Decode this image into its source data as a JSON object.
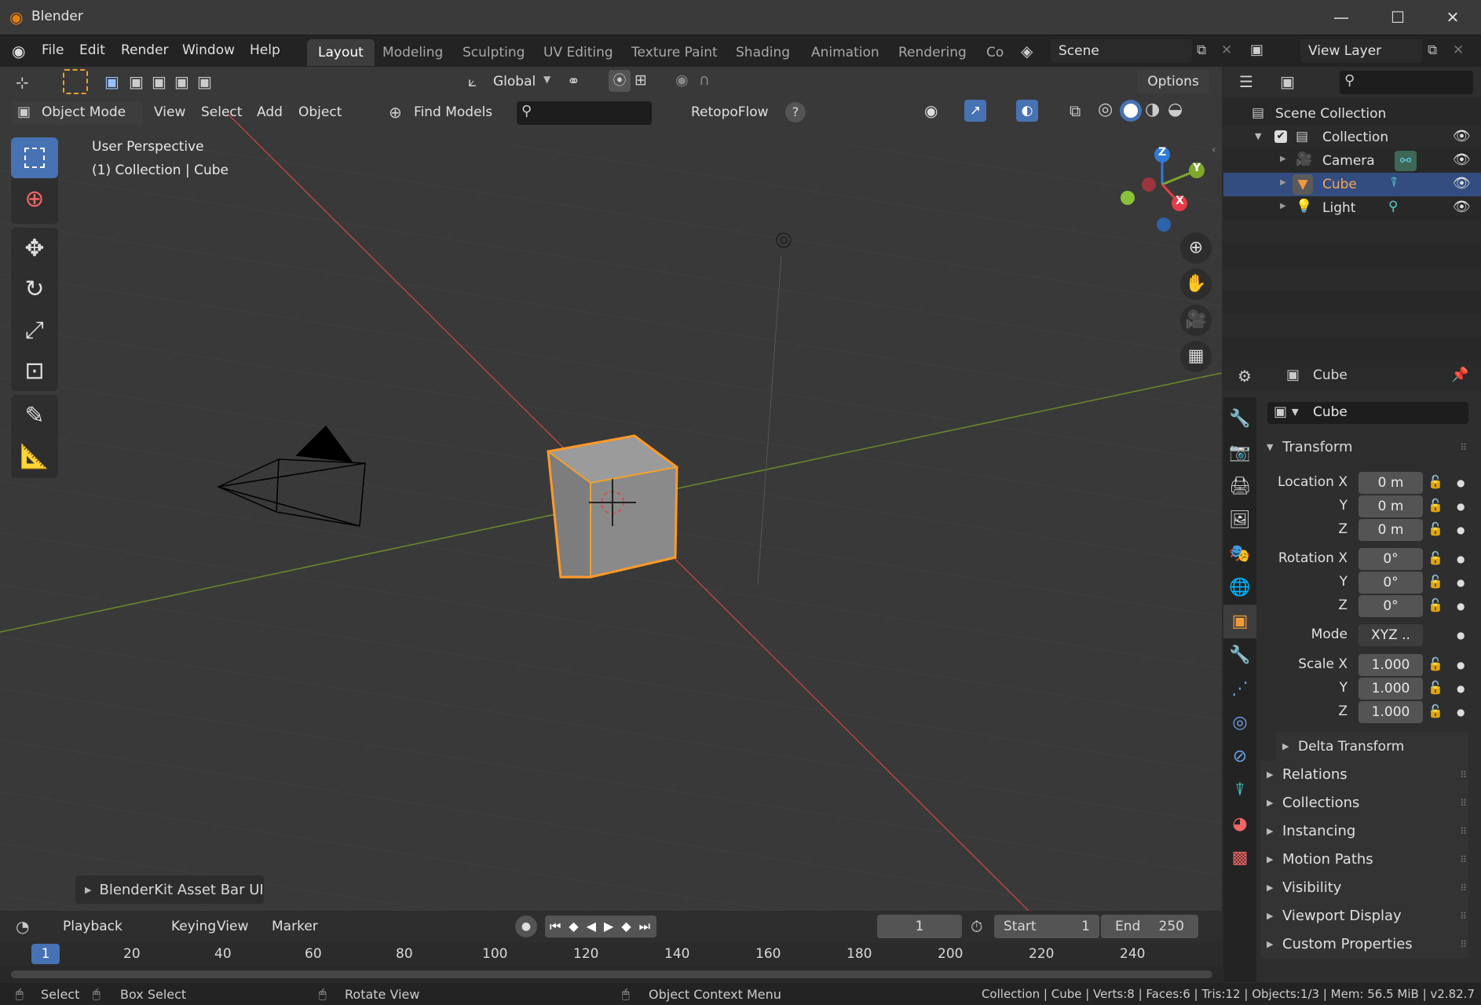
{
  "window": {
    "title": "Blender",
    "minimize": "—",
    "maximize": "☐",
    "close": "✕"
  },
  "menus": [
    "File",
    "Edit",
    "Render",
    "Window",
    "Help"
  ],
  "workspaces": [
    "Layout",
    "Modeling",
    "Sculpting",
    "UV Editing",
    "Texture Paint",
    "Shading",
    "Animation",
    "Rendering",
    "Co"
  ],
  "scene": {
    "name": "Scene",
    "view_layer": "View Layer"
  },
  "toolbar": {
    "transform_orientation": "Global",
    "options": "Options"
  },
  "viewport_header": {
    "mode": "Object Mode",
    "view": "View",
    "select": "Select",
    "add": "Add",
    "object": "Object",
    "find_models": "Find Models",
    "retopoflow": "RetopoFlow"
  },
  "viewport": {
    "perspective": "User Perspective",
    "collection_info": "(1) Collection | Cube",
    "blenderkit": "BlenderKit Asset Bar UI",
    "gizmo": {
      "x": "X",
      "y": "Y",
      "z": "Z"
    }
  },
  "outliner": {
    "root": "Scene Collection",
    "collection": "Collection",
    "items": [
      {
        "name": "Camera"
      },
      {
        "name": "Cube"
      },
      {
        "name": "Light"
      }
    ]
  },
  "properties": {
    "object_name": "Cube",
    "data_name": "Cube",
    "transform_title": "Transform",
    "location": {
      "label": "Location X",
      "x": "0 m",
      "y": "0 m",
      "z": "0 m"
    },
    "rotation": {
      "label": "Rotation X",
      "x": "0°",
      "y": "0°",
      "z": "0°"
    },
    "mode": {
      "label": "Mode",
      "value": "XYZ .."
    },
    "scale": {
      "label": "Scale X",
      "x": "1.000",
      "y": "1.000",
      "z": "1.000"
    },
    "axis_y": "Y",
    "axis_z": "Z",
    "delta_transform": "Delta Transform",
    "panels": [
      "Relations",
      "Collections",
      "Instancing",
      "Motion Paths",
      "Visibility",
      "Viewport Display",
      "Custom Properties"
    ]
  },
  "timeline": {
    "playback": "Playback",
    "keying": "Keying",
    "view": "View",
    "marker": "Marker",
    "current_frame": "1",
    "start_label": "Start",
    "start": "1",
    "end_label": "End",
    "end": "250",
    "ruler": [
      "20",
      "40",
      "60",
      "80",
      "100",
      "120",
      "140",
      "160",
      "180",
      "200",
      "220",
      "240"
    ],
    "playhead": "1"
  },
  "statusbar": {
    "select": "Select",
    "box_select": "Box Select",
    "rotate_view": "Rotate View",
    "context_menu": "Object Context Menu",
    "stats": "Collection | Cube | Verts:8 | Faces:6 | Tris:12 | Objects:1/3 | Mem: 56.5 MiB | v2.82.7"
  }
}
